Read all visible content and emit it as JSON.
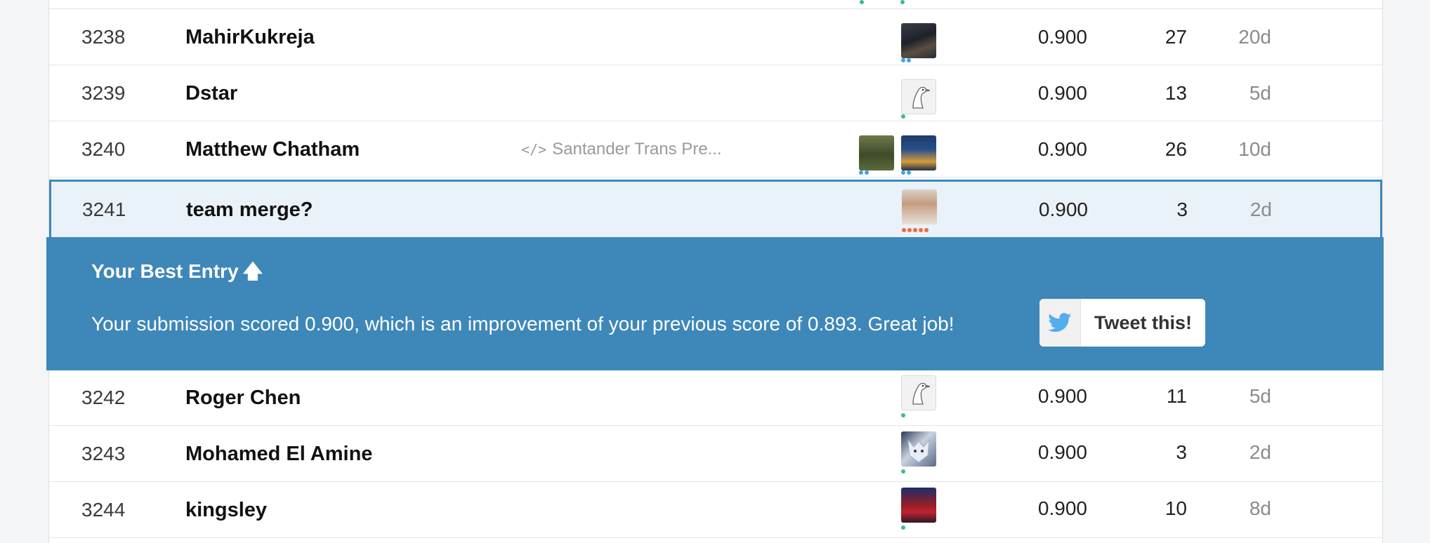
{
  "rows_before": [
    {
      "rank": "3238",
      "team": "MahirKukreja",
      "kernel": "",
      "score": "0.900",
      "entries": "27",
      "last": "20d"
    },
    {
      "rank": "3239",
      "team": "Dstar",
      "kernel": "",
      "score": "0.900",
      "entries": "13",
      "last": "5d"
    },
    {
      "rank": "3240",
      "team": "Matthew Chatham",
      "kernel": "Santander Trans Pre...",
      "score": "0.900",
      "entries": "26",
      "last": "10d"
    }
  ],
  "my_row": {
    "rank": "3241",
    "team": "team merge?",
    "score": "0.900",
    "entries": "3",
    "last": "2d"
  },
  "banner": {
    "title": "Your Best Entry",
    "title_arrow": "🡅",
    "message": "Your submission scored 0.900, which is an improvement of your previous score of 0.893. Great job!",
    "tweet_label": "Tweet this!"
  },
  "rows_after": [
    {
      "rank": "3242",
      "team": "Roger Chen",
      "score": "0.900",
      "entries": "11",
      "last": "5d"
    },
    {
      "rank": "3243",
      "team": "Mohamed El Amine",
      "score": "0.900",
      "entries": "3",
      "last": "2d"
    },
    {
      "rank": "3244",
      "team": "kingsley",
      "score": "0.900",
      "entries": "10",
      "last": "8d"
    }
  ],
  "icons": {
    "kernel": "code-icon",
    "arrow": "arrow-up-icon",
    "twitter": "twitter-bird-icon"
  },
  "colors": {
    "accent": "#3e87b9",
    "highlight_bg": "#eaf2f9",
    "tier_green": "#3dbb8e",
    "tier_blue": "#3ea3e8",
    "tier_orange": "#f06a3c",
    "twitter": "#55acee"
  }
}
